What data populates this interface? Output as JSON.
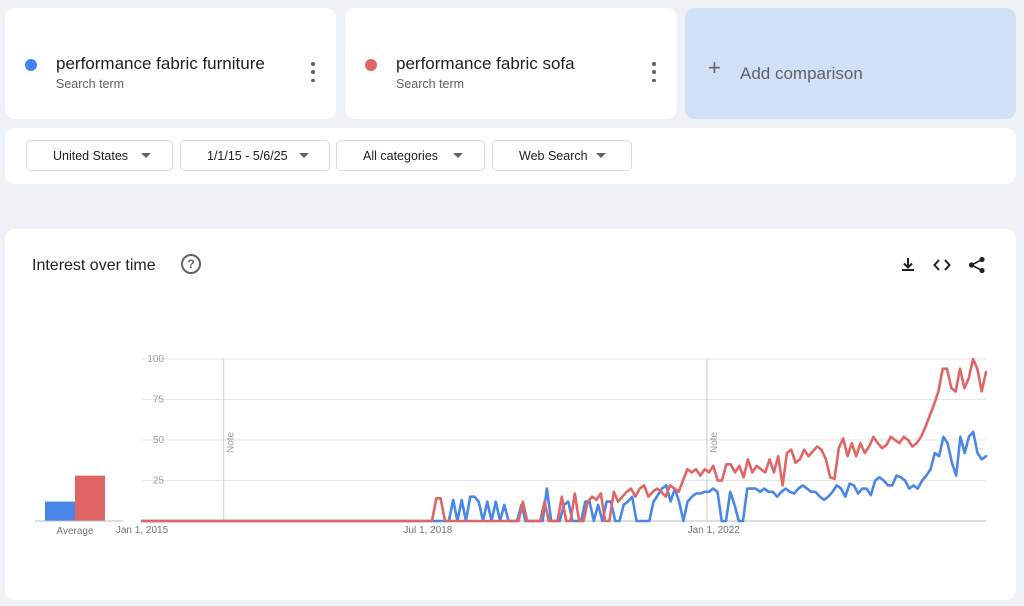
{
  "terms": [
    {
      "name": "performance fabric furniture",
      "subtitle": "Search term",
      "color": "#4285f4"
    },
    {
      "name": "performance fabric sofa",
      "subtitle": "Search term",
      "color": "#db4437"
    }
  ],
  "add_comparison": {
    "label": "Add comparison"
  },
  "filters": {
    "region": "United States",
    "date_range": "1/1/15 - 5/6/25",
    "category": "All categories",
    "source": "Web Search"
  },
  "chart_section": {
    "title": "Interest over time",
    "help_glyph": "?",
    "average_label": "Average",
    "note_label": "Note",
    "icons": [
      "download-icon",
      "embed-code-icon",
      "share-icon"
    ]
  },
  "chart_data": {
    "type": "line",
    "title": "",
    "ylim": [
      0,
      100
    ],
    "yticks": [
      "25",
      "50",
      "75",
      "100"
    ],
    "x_tick_labels": [
      "Jan 1, 2015",
      "Jul 1, 2018",
      "Jan 1, 2022"
    ],
    "x_range": [
      "2015-01",
      "2025-05"
    ],
    "notes": [
      "2016-01",
      "2021-12"
    ],
    "averages": [
      12,
      28
    ],
    "series": [
      {
        "color": "#4285f4",
        "values": [
          0,
          0,
          0,
          0,
          0,
          0,
          0,
          0,
          0,
          0,
          0,
          0,
          0,
          0,
          0,
          0,
          0,
          0,
          0,
          0,
          0,
          0,
          0,
          0,
          0,
          0,
          0,
          0,
          0,
          0,
          0,
          0,
          0,
          0,
          0,
          0,
          0,
          0,
          0,
          0,
          0,
          0,
          0,
          0,
          0,
          0,
          0,
          0,
          0,
          0,
          0,
          0,
          0,
          0,
          0,
          0,
          0,
          0,
          0,
          0,
          0,
          0,
          0,
          0,
          0,
          0,
          0,
          0,
          0,
          0,
          0,
          0,
          0,
          13,
          0,
          13,
          0,
          15,
          15,
          12,
          0,
          12,
          0,
          12,
          0,
          10,
          0,
          0,
          0,
          10,
          0,
          0,
          0,
          0,
          0,
          20,
          0,
          0,
          0,
          10,
          12,
          0,
          0,
          0,
          12,
          12,
          0,
          10,
          0,
          12,
          12,
          0,
          0,
          10,
          12,
          15,
          0,
          0,
          0,
          0,
          12,
          16,
          20,
          22,
          12,
          20,
          12,
          0,
          12,
          15,
          17,
          17,
          18,
          18,
          20,
          18,
          0,
          0,
          18,
          10,
          0,
          0,
          20,
          20,
          20,
          18,
          20,
          18,
          18,
          15,
          18,
          20,
          18,
          17,
          20,
          22,
          20,
          18,
          18,
          15,
          13,
          15,
          18,
          22,
          20,
          15,
          23,
          22,
          17,
          20,
          20,
          16,
          25,
          27,
          25,
          22,
          22,
          28,
          27,
          25,
          20,
          22,
          20,
          25,
          28,
          32,
          42,
          40,
          52,
          48,
          36,
          28,
          52,
          42,
          52,
          55,
          42,
          38,
          40
        ]
      },
      {
        "color": "#db4437",
        "values": [
          0,
          0,
          0,
          0,
          0,
          0,
          0,
          0,
          0,
          0,
          0,
          0,
          0,
          0,
          0,
          0,
          0,
          0,
          0,
          0,
          0,
          0,
          0,
          0,
          0,
          0,
          0,
          0,
          0,
          0,
          0,
          0,
          0,
          0,
          0,
          0,
          0,
          0,
          0,
          0,
          0,
          0,
          0,
          0,
          0,
          0,
          0,
          0,
          0,
          0,
          0,
          0,
          0,
          0,
          0,
          0,
          0,
          0,
          0,
          0,
          0,
          0,
          0,
          0,
          0,
          0,
          0,
          0,
          14,
          14,
          0,
          0,
          0,
          0,
          0,
          0,
          0,
          0,
          0,
          0,
          0,
          0,
          0,
          0,
          0,
          0,
          0,
          0,
          12,
          0,
          0,
          0,
          0,
          12,
          0,
          0,
          0,
          15,
          0,
          0,
          17,
          0,
          0,
          12,
          15,
          13,
          17,
          0,
          0,
          18,
          12,
          15,
          18,
          20,
          15,
          20,
          22,
          15,
          18,
          20,
          18,
          15,
          22,
          20,
          18,
          25,
          32,
          30,
          32,
          28,
          32,
          30,
          34,
          25,
          25,
          35,
          35,
          30,
          34,
          27,
          38,
          30,
          34,
          32,
          30,
          38,
          30,
          40,
          22,
          42,
          44,
          36,
          38,
          44,
          40,
          43,
          46,
          44,
          38,
          27,
          26,
          45,
          51,
          40,
          48,
          40,
          48,
          42,
          46,
          52,
          48,
          45,
          47,
          52,
          50,
          48,
          52,
          50,
          46,
          48,
          52,
          58,
          65,
          72,
          80,
          94,
          94,
          82,
          80,
          94,
          82,
          88,
          100,
          94,
          80,
          92
        ]
      }
    ]
  }
}
